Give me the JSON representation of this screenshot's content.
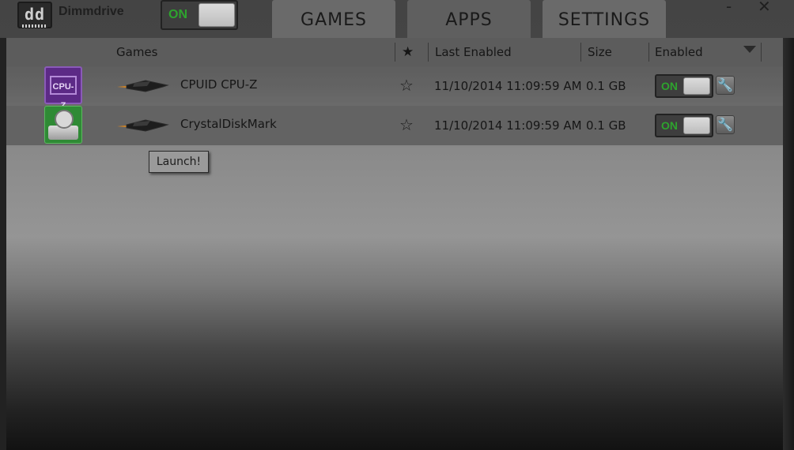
{
  "app": {
    "title": "Dimmdrive",
    "logo_text": "dd",
    "master_toggle": "ON",
    "minimize_glyph": "-",
    "close_glyph": "✕"
  },
  "tabs": [
    {
      "label": "GAMES",
      "active": false
    },
    {
      "label": "APPS",
      "active": true
    },
    {
      "label": "SETTINGS",
      "active": false
    }
  ],
  "table": {
    "columns": {
      "games": "Games",
      "favorite": "★",
      "last_enabled": "Last Enabled",
      "size": "Size",
      "enabled": "Enabled"
    },
    "rows": [
      {
        "icon": "cpuz-icon",
        "icon_text": "CPU-Z",
        "name": "CPUID CPU-Z",
        "favorite": "☆",
        "last_enabled": "11/10/2014 11:09:59 AM",
        "size": "0.1 GB",
        "enabled": "ON"
      },
      {
        "icon": "crystaldiskmark-icon",
        "name": "CrystalDiskMark",
        "favorite": "☆",
        "last_enabled": "11/10/2014 11:09:59 AM",
        "size": "0.1 GB",
        "enabled": "ON"
      }
    ]
  },
  "tooltip": "Launch!",
  "colors": {
    "on_green": "#2ea32e",
    "cpuz_purple": "#5c2a86",
    "crystal_green": "#2f8a35"
  }
}
